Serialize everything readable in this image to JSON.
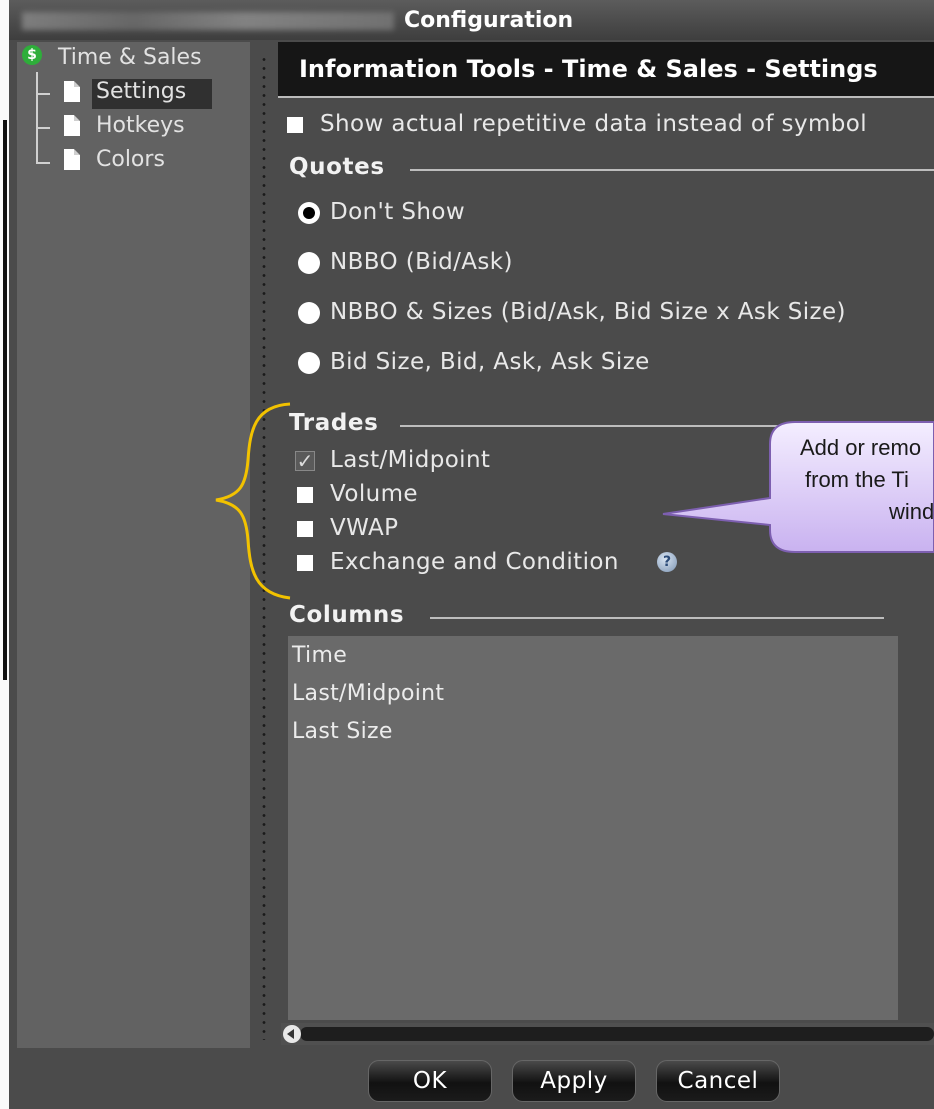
{
  "window": {
    "title": "Configuration"
  },
  "tree": {
    "root": "Time & Sales",
    "root_icon": "dollar-badge-icon",
    "items": [
      {
        "label": "Settings",
        "selected": true
      },
      {
        "label": "Hotkeys",
        "selected": false
      },
      {
        "label": "Colors",
        "selected": false
      }
    ]
  },
  "panel": {
    "title": "Information Tools - Time & Sales - Settings",
    "show_repetitive_label": "Show actual repetitive data instead of symbol",
    "show_repetitive_checked": false
  },
  "quotes": {
    "heading": "Quotes",
    "options": [
      {
        "label": "Don't Show",
        "selected": true
      },
      {
        "label": "NBBO (Bid/Ask)",
        "selected": false
      },
      {
        "label": "NBBO & Sizes (Bid/Ask, Bid Size x Ask Size)",
        "selected": false
      },
      {
        "label": "Bid Size, Bid, Ask, Ask Size",
        "selected": false
      }
    ]
  },
  "trades": {
    "heading": "Trades",
    "options": [
      {
        "label": "Last/Midpoint",
        "checked": true
      },
      {
        "label": "Volume",
        "checked": false
      },
      {
        "label": "VWAP",
        "checked": false
      },
      {
        "label": "Exchange and Condition",
        "checked": false
      }
    ]
  },
  "callout": {
    "lines": [
      "Add or remo",
      "from the Ti",
      "wind"
    ],
    "color": "#d9c8f5"
  },
  "columns": {
    "heading": "Columns",
    "items": [
      "Time",
      "Last/Midpoint",
      "Last Size"
    ]
  },
  "buttons": {
    "ok": "OK",
    "apply": "Apply",
    "cancel": "Cancel"
  },
  "colors": {
    "window_bg": "#4b4b4b",
    "tree_bg": "#626262",
    "annotation_bracket": "#f2c200"
  }
}
